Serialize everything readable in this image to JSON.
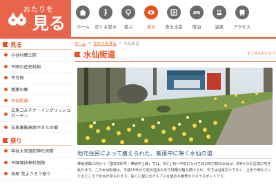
{
  "header": {
    "logo_small": "おたりを",
    "logo_big": "見る"
  },
  "nav": [
    {
      "label": "ホーム",
      "icon": "home-icon"
    },
    {
      "label": "歩く＆登る",
      "icon": "hiking-icon"
    },
    {
      "label": "遊ぶ",
      "icon": "play-icon"
    },
    {
      "label": "見る",
      "icon": "eye-icon",
      "active": true
    },
    {
      "label": "食＆土産",
      "icon": "food-icon"
    },
    {
      "label": "宿泊",
      "icon": "lodging-icon"
    },
    {
      "label": "温泉",
      "icon": "hot-spring-icon"
    },
    {
      "label": "アクセス",
      "icon": "access-icon"
    }
  ],
  "sidebar": {
    "section1": "見る",
    "items": [
      {
        "label": "小谷村郷土館"
      },
      {
        "label": "千国の庄史料館"
      },
      {
        "label": "牛方宿"
      },
      {
        "label": "親猿の郷"
      },
      {
        "label": "水仙街道",
        "active": true
      },
      {
        "label": "白馬コルチナ・イングリッシュガーデン"
      },
      {
        "label": "白馬乗鞍高原ホタルの郷"
      }
    ],
    "section2": "祭り",
    "items2": [
      {
        "label": "中谷大宮諏訪神社例祭"
      },
      {
        "label": "千国諏訪神社例祭"
      },
      {
        "label": "深原 花ようろう祭り"
      }
    ]
  },
  "breadcrumb": {
    "home": "ホーム",
    "sep1": ">",
    "parent": "おたりを見る",
    "sep2": ">",
    "current": "水仙街道"
  },
  "main": {
    "title": "水仙街道",
    "to_list": "すいせんかいどう",
    "subheading": "地元住民によって植えられた、集落中に咲く水仙の道",
    "body": "奉納通路に向かう「国道330号・奉納中土線」では、4月上旬〜中旬にかけて約100万株の水仙が、約6キロの沿道に咲き乱れます。この水仙街道は、平成15年から地元住民の手で球根が植え続けられ、今では沿道だけでなく、土手や畑などいたるところで水仙が見られます。遠くに望む北アルプスを望める絶景のカメラスポットです。"
  },
  "colors": {
    "accent": "#e8501e",
    "logo_bg": "#e8644a",
    "nav_icon": "#6b6b6b",
    "subheading": "#2b4a6f"
  }
}
